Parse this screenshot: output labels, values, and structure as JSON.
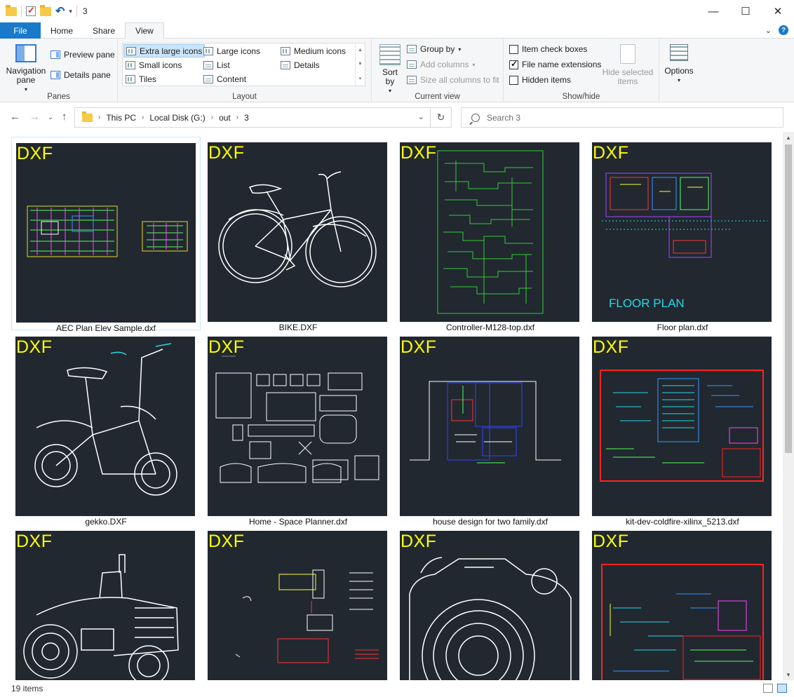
{
  "window": {
    "title": "3",
    "controls": {
      "minimize": "—",
      "maximize": "☐",
      "close": "✕"
    }
  },
  "tabs": [
    {
      "label": "File"
    },
    {
      "label": "Home"
    },
    {
      "label": "Share"
    },
    {
      "label": "View"
    }
  ],
  "ribbon": {
    "panes": {
      "group_label": "Panes",
      "navigation_pane": "Navigation pane",
      "preview_pane": "Preview pane",
      "details_pane": "Details pane"
    },
    "layout": {
      "group_label": "Layout",
      "items": [
        "Extra large icons",
        "Large icons",
        "Medium icons",
        "Small icons",
        "List",
        "Details",
        "Tiles",
        "Content"
      ],
      "selected": "Extra large icons"
    },
    "current_view": {
      "group_label": "Current view",
      "sort_by": "Sort by",
      "group_by": "Group by",
      "add_columns": "Add columns",
      "size_columns": "Size all columns to fit"
    },
    "show_hide": {
      "group_label": "Show/hide",
      "item_check_boxes": "Item check boxes",
      "file_name_extensions": "File name extensions",
      "hidden_items": "Hidden items",
      "hide_selected": "Hide selected items",
      "checked": {
        "item_check_boxes": false,
        "file_name_extensions": true,
        "hidden_items": false
      }
    },
    "options": {
      "label": "Options"
    }
  },
  "address": {
    "crumbs": [
      "This PC",
      "Local Disk (G:)",
      "out",
      "3"
    ]
  },
  "search": {
    "placeholder": "Search 3"
  },
  "files": [
    {
      "name": "AEC Plan Elev Sample.dxf",
      "badge": "DXF"
    },
    {
      "name": "BIKE.DXF",
      "badge": "DXF"
    },
    {
      "name": "Controller-M128-top.dxf",
      "badge": "DXF"
    },
    {
      "name": "Floor plan.dxf",
      "badge": "DXF",
      "overlay": "FLOOR PLAN"
    },
    {
      "name": "gekko.DXF",
      "badge": "DXF"
    },
    {
      "name": "Home - Space Planner.dxf",
      "badge": "DXF"
    },
    {
      "name": "house design for two family.dxf",
      "badge": "DXF"
    },
    {
      "name": "kit-dev-coldfire-xilinx_5213.dxf",
      "badge": "DXF"
    },
    {
      "name": "",
      "badge": "DXF"
    },
    {
      "name": "",
      "badge": "DXF"
    },
    {
      "name": "",
      "badge": "DXF"
    },
    {
      "name": "",
      "badge": "DXF"
    }
  ],
  "status": {
    "item_count": "19 items"
  },
  "colors": {
    "accent": "#1979ca",
    "thumb_bg": "#212830",
    "badge": "#ffff00"
  }
}
